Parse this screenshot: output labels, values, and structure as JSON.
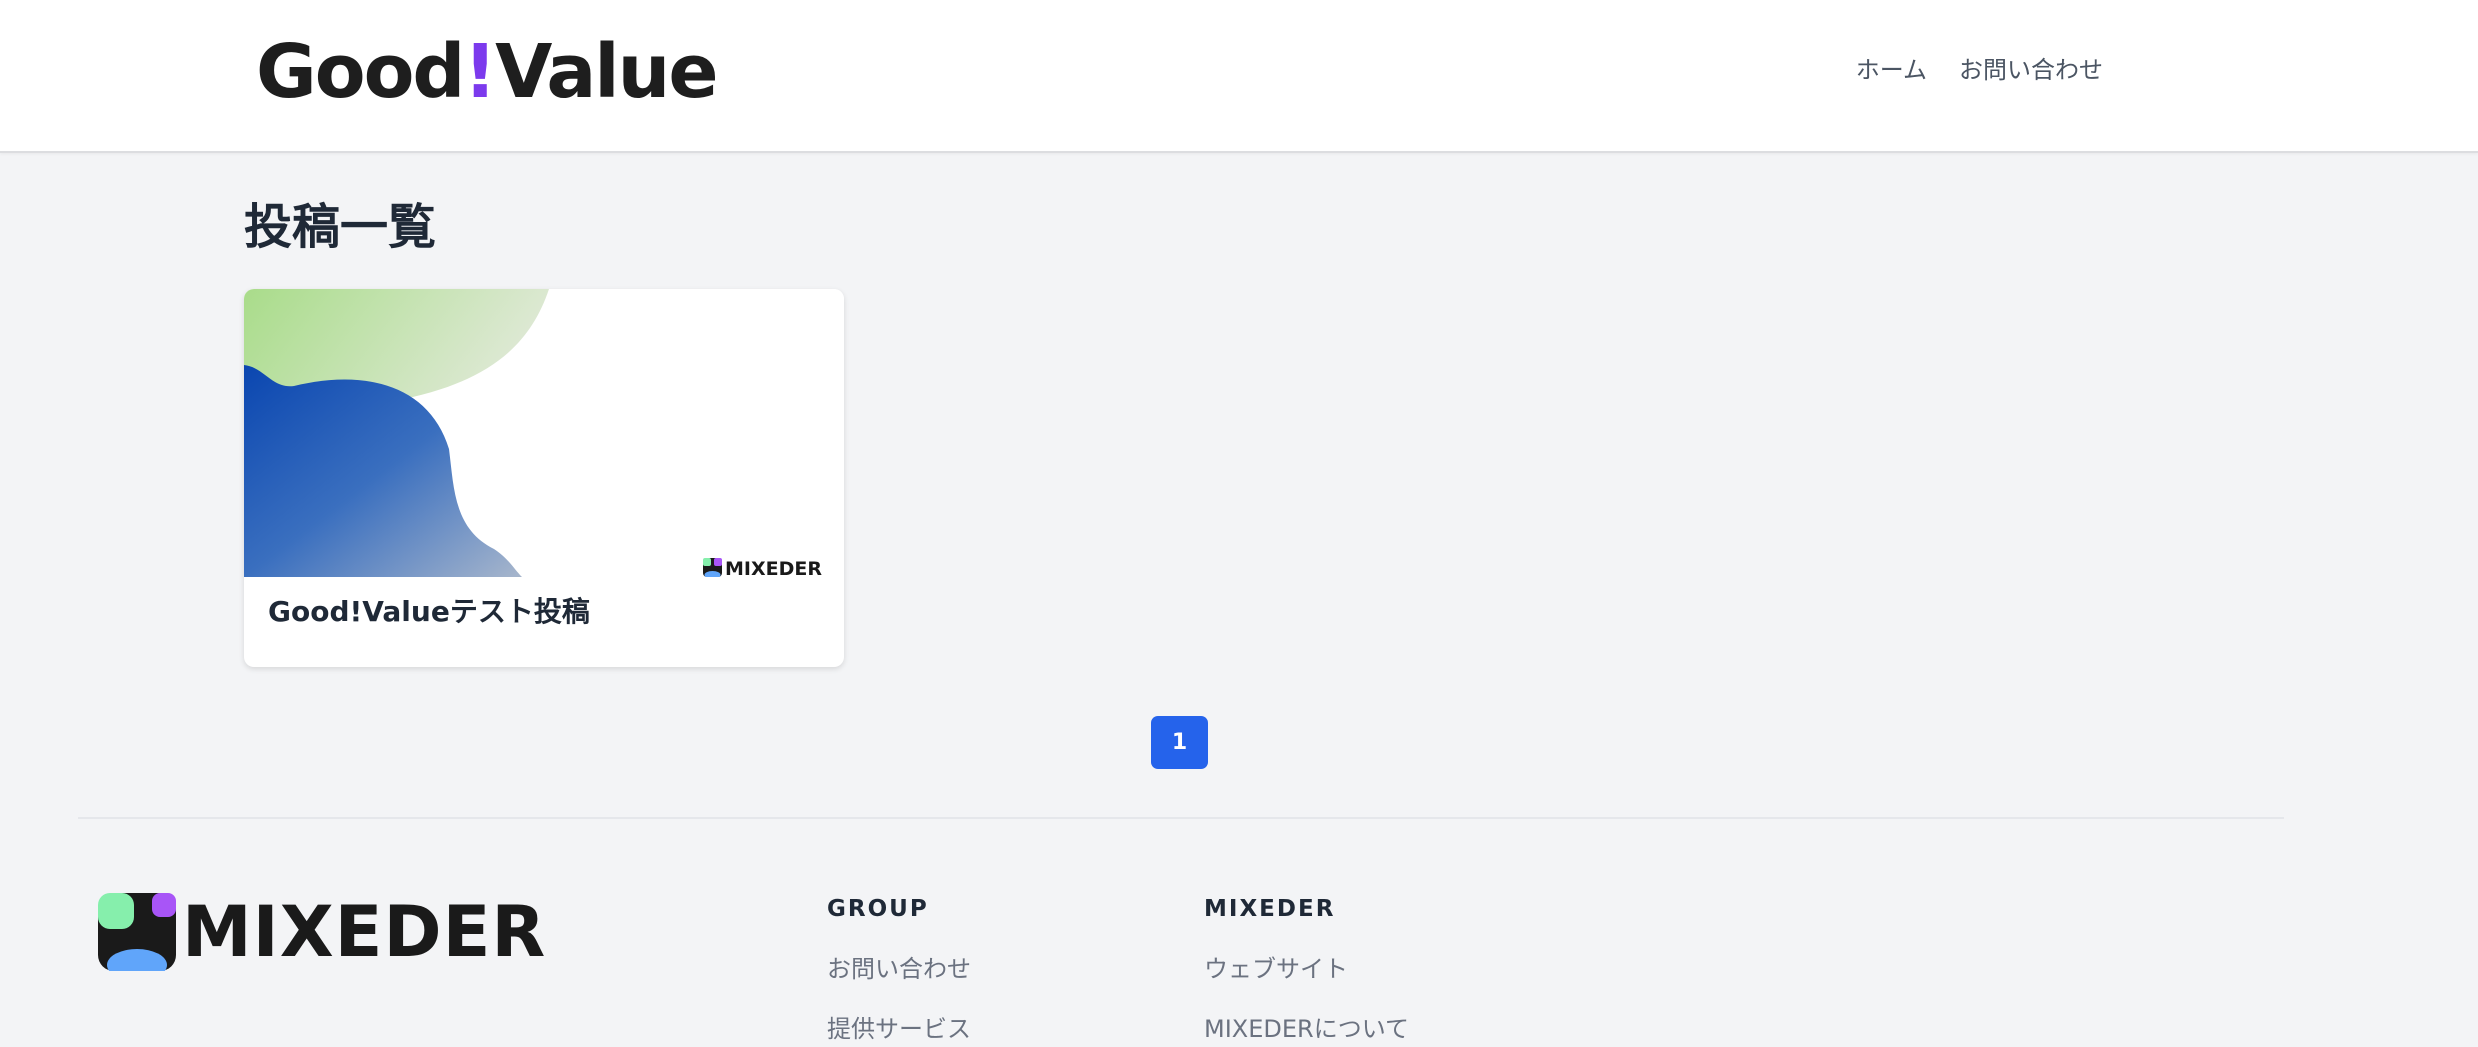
{
  "header": {
    "logo": {
      "part1": "Good",
      "bang": "!",
      "part2": "Value"
    },
    "nav": [
      {
        "label": "ホーム"
      },
      {
        "label": "お問い合わせ"
      }
    ]
  },
  "main": {
    "title": "投稿一覧",
    "posts": [
      {
        "thumbnail_brand": "MIXEDER",
        "title": "Good!Valueテスト投稿"
      }
    ],
    "pagination": {
      "current": "1"
    }
  },
  "footer": {
    "brand": "MIXEDER",
    "columns": [
      {
        "heading": "GROUP",
        "links": [
          "お問い合わせ",
          "提供サービス"
        ]
      },
      {
        "heading": "MIXEDER",
        "links": [
          "ウェブサイト",
          "MIXEDERについて"
        ]
      }
    ]
  },
  "colors": {
    "accent": "#7c3aed",
    "pagination_active": "#2563eb",
    "background": "#f3f4f6"
  }
}
